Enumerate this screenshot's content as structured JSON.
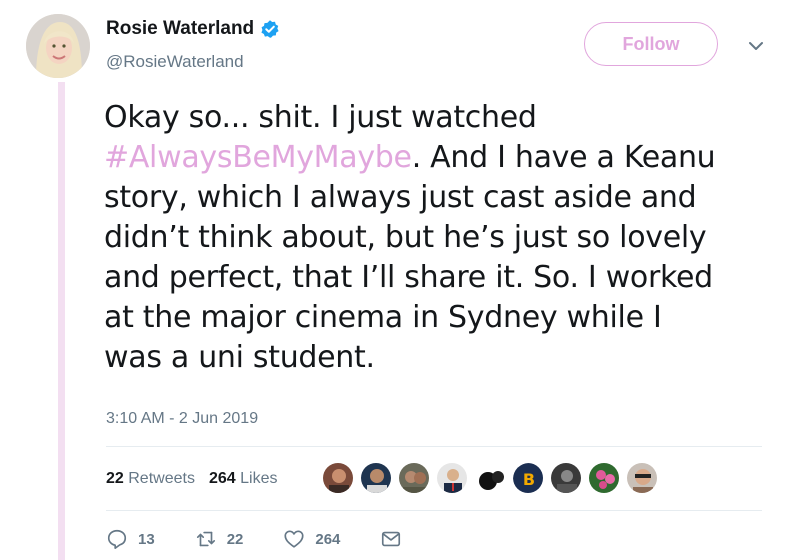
{
  "author": {
    "name": "Rosie Waterland",
    "handle": "@RosieWaterland",
    "verified": true
  },
  "follow_label": "Follow",
  "tweet": {
    "lines": [
      "Okay so... shit. I just watched",
      ". And I have a Keanu",
      "story, which I always just cast aside and",
      "didn’t think about, but he’s just so lovely",
      "and perfect, that I’ll share it. So. I worked",
      "at the major cinema in Sydney while I",
      "was a uni student."
    ],
    "hashtag": "#AlwaysBeMyMaybe"
  },
  "timestamp": "3:10 AM - 2 Jun 2019",
  "stats": {
    "retweets_count": "22",
    "retweets_label": "Retweets",
    "likes_count": "264",
    "likes_label": "Likes"
  },
  "actions": {
    "reply_count": "13",
    "retweet_count": "22",
    "like_count": "264"
  },
  "colors": {
    "accent": "#e1a6dd",
    "thread_line": "#f3dff1",
    "secondary_text": "#657786",
    "verified": "#1da1f2"
  },
  "icons": [
    "verified-icon",
    "chevron-down-icon",
    "reply-icon",
    "retweet-icon",
    "heart-icon",
    "message-icon"
  ]
}
